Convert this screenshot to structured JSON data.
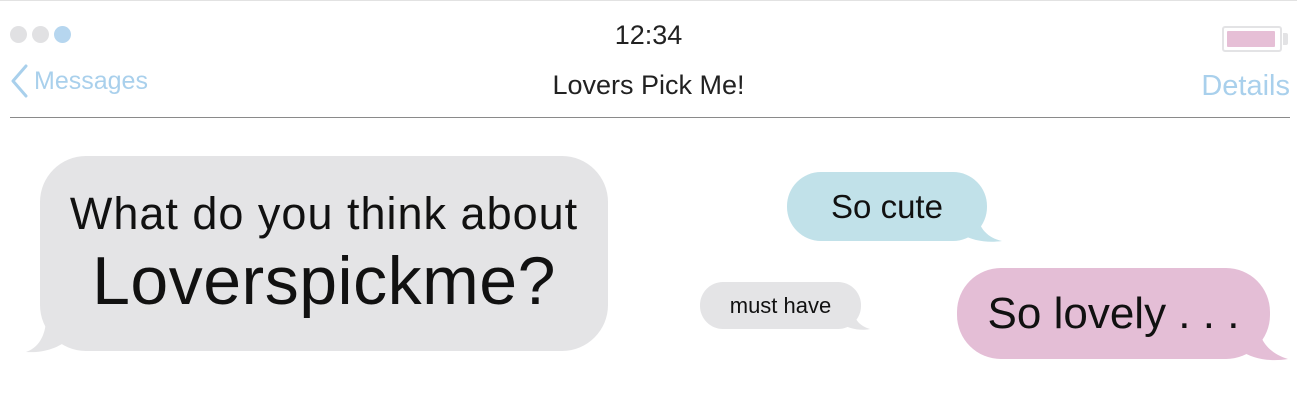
{
  "status_bar": {
    "time": "12:34",
    "signal_dots_total": 3,
    "signal_dots_active": 1,
    "battery_level": 0.95,
    "battery_color": "#e6bfd6"
  },
  "nav": {
    "back_label": "Messages",
    "title": "Lovers Pick Me!",
    "details_label": "Details",
    "accent_color": "#a9d0ec"
  },
  "messages": [
    {
      "line1": "What do you think about",
      "line2": "Loverspickme?",
      "color": "#e4e4e6"
    },
    {
      "text": "So cute",
      "color": "#c1e1e9"
    },
    {
      "text": "must have",
      "color": "#e4e4e6"
    },
    {
      "text": "So lovely . . .",
      "color": "#e4bed6"
    }
  ]
}
